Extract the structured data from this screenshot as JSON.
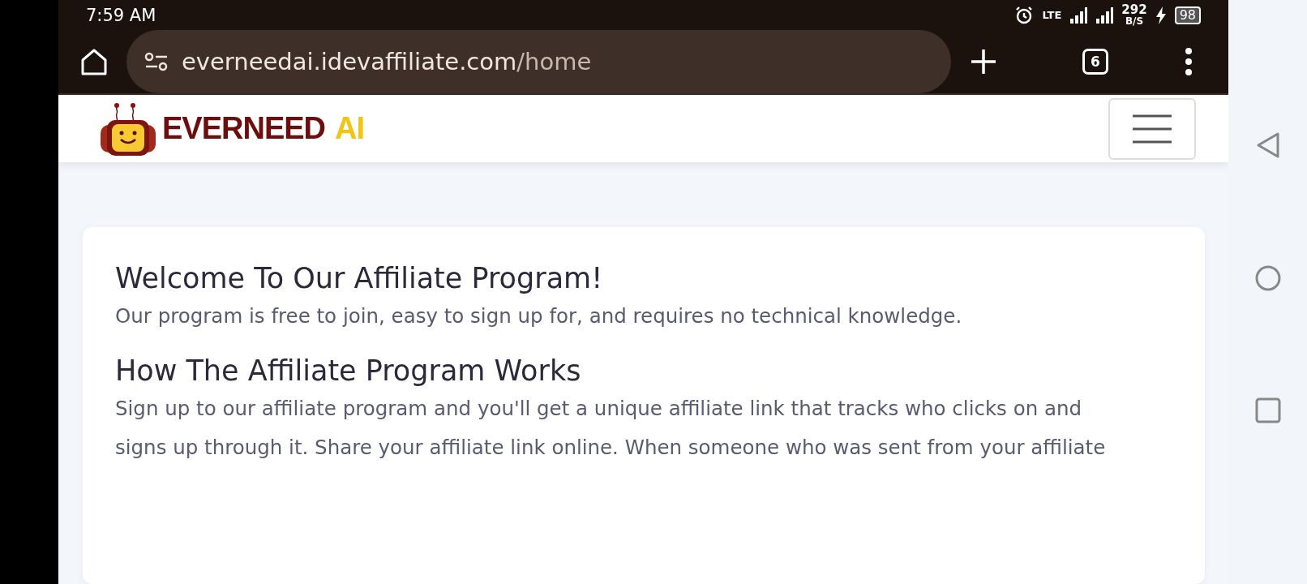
{
  "status_bar": {
    "time": "7:59 AM",
    "network": "LTE",
    "speed": "292",
    "speed_unit": "B/S",
    "battery": "98"
  },
  "browser": {
    "url_host": "everneedai.idevaffiliate.com",
    "url_path": "/home",
    "tab_count": "6"
  },
  "header": {
    "logo_main": "EVERNEED",
    "logo_accent": "AI"
  },
  "sections": [
    {
      "heading": "Welcome To Our Affiliate Program!",
      "text": "Our program is free to join, easy to sign up for, and requires no technical knowledge."
    },
    {
      "heading": "How The Affiliate Program Works",
      "text": "Sign up to our affiliate program and you'll get a unique affiliate link that tracks who clicks on and\nsigns up through it. Share your affiliate link online. When someone who was sent from your affiliate"
    }
  ]
}
